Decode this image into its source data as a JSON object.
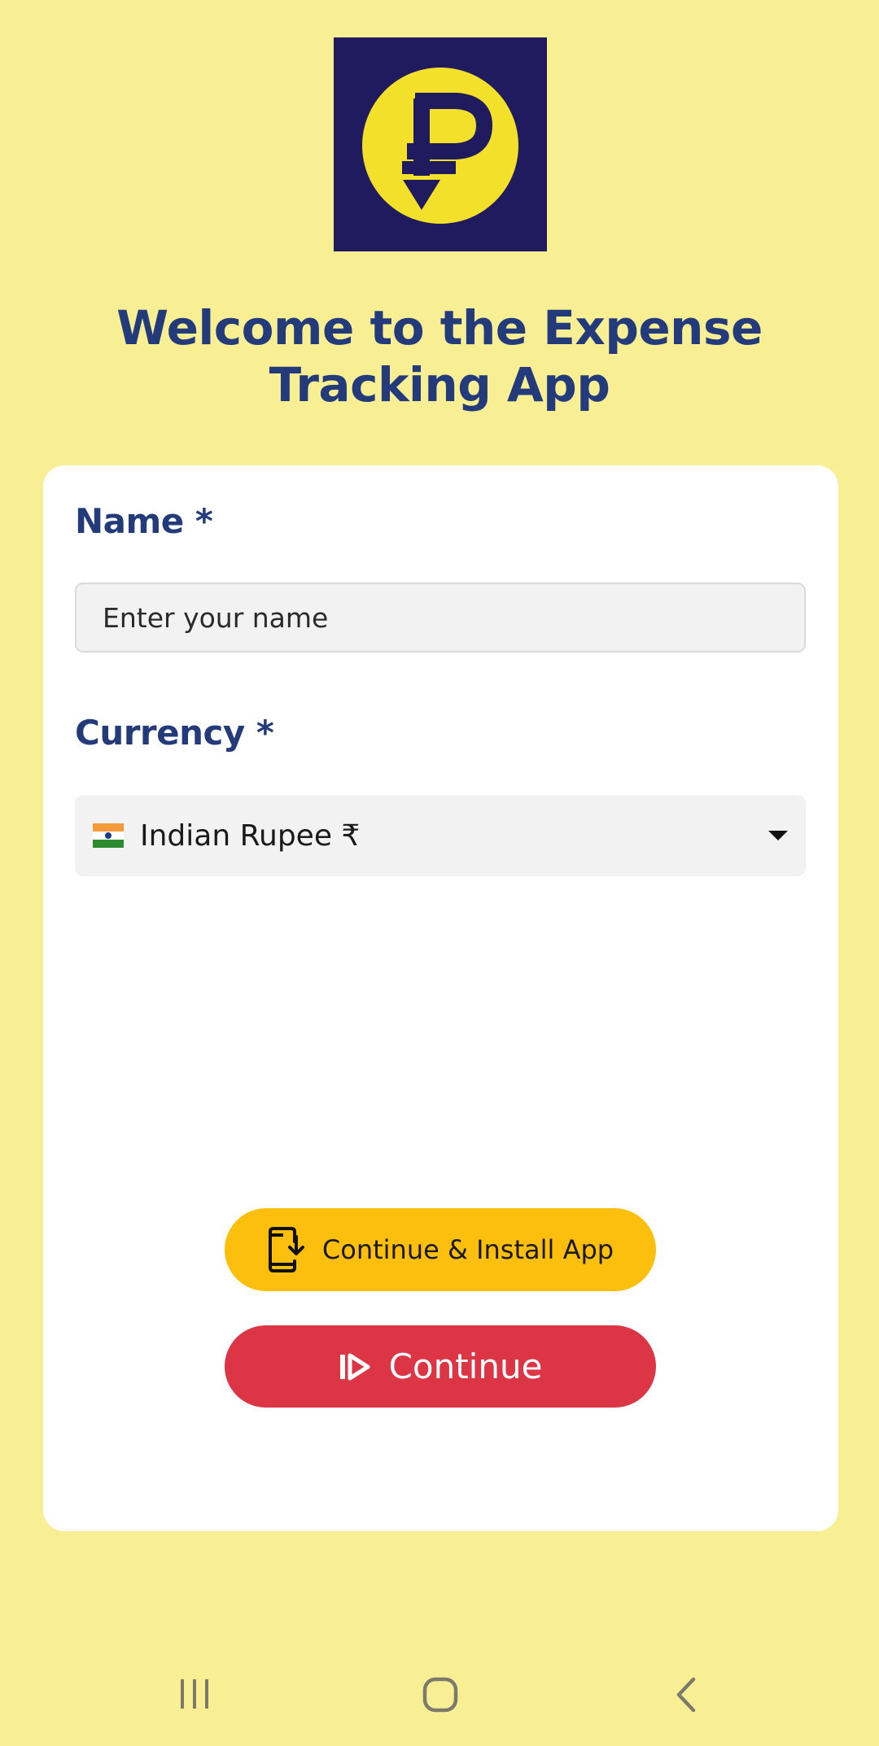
{
  "logo": {
    "icon": "ruble-download-logo",
    "colors": {
      "background": "#1f1b5e",
      "circle": "#f2e02a",
      "glyph": "#1f1b5e"
    }
  },
  "title": "Welcome to the Expense Tracking App",
  "form": {
    "name_label": "Name *",
    "name_placeholder": "Enter your name",
    "name_value": "",
    "currency_label": "Currency *",
    "currency_selected": "Indian Rupee ₹",
    "currency_flag": "india-flag-icon"
  },
  "buttons": {
    "install_label": "Continue & Install App",
    "install_icon": "phone-download-icon",
    "continue_label": "Continue",
    "continue_icon": "step-forward-icon"
  },
  "colors": {
    "page_background": "#f8ef94",
    "title": "#233b7a",
    "install_button": "#fdbf0e",
    "continue_button": "#dc3545"
  },
  "navbar": {
    "recent": "recent-apps-icon",
    "home": "home-icon",
    "back": "back-icon"
  }
}
